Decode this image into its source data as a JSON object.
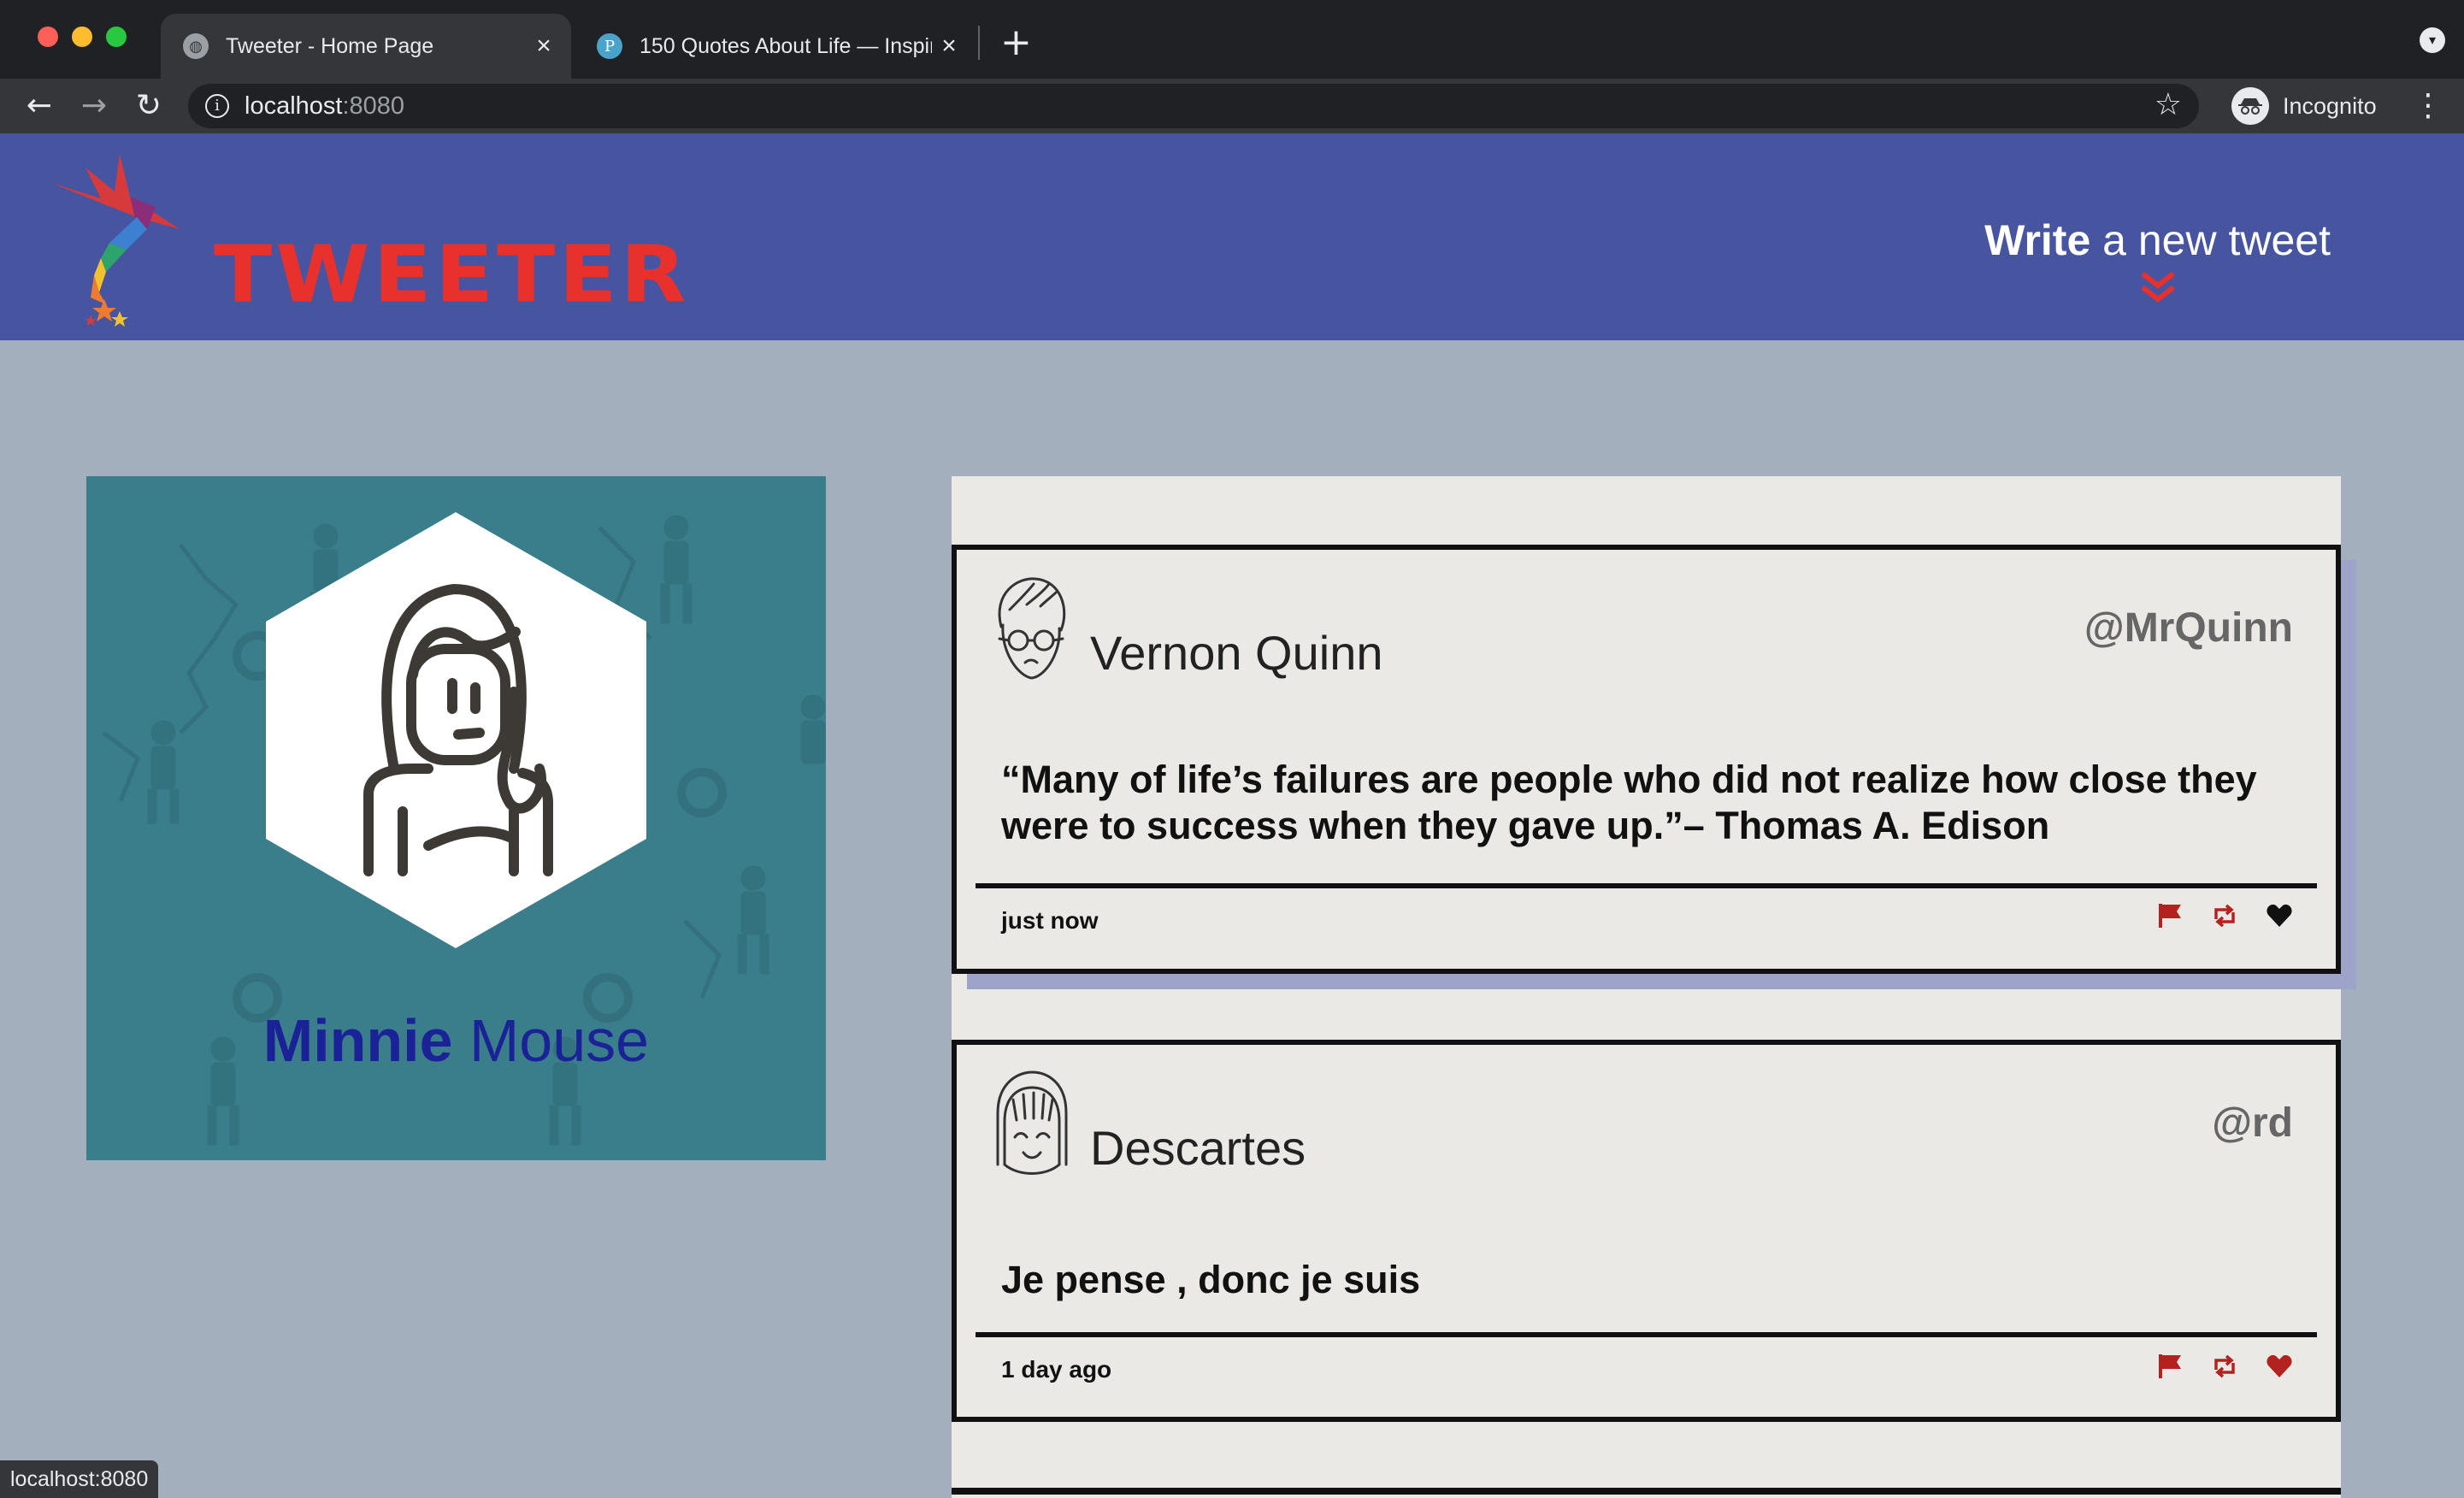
{
  "browser": {
    "tabs": [
      {
        "title": "Tweeter - Home Page",
        "favicon": "globe-icon",
        "active": true
      },
      {
        "title": "150 Quotes About Life — Inspir",
        "favicon": "P",
        "active": false
      }
    ],
    "address": {
      "host": "localhost",
      "port": ":8080"
    },
    "profile_label": "Incognito",
    "status_url": "localhost:8080"
  },
  "header": {
    "brand": "TWEETER",
    "compose_bold": "Write",
    "compose_rest": " a new tweet",
    "colors": {
      "nav": "#4755a1",
      "accent": "#e8302d"
    }
  },
  "profile": {
    "first_name": "Minnie",
    "last_name": "Mouse",
    "colors": {
      "card": "#3a7d8b",
      "name": "#1b2196"
    }
  },
  "tweets": [
    {
      "author": "Vernon Quinn",
      "handle": "@MrQuinn",
      "text": "“Many of life’s failures are people who did not realize how close they were to success when they gave up.”– Thomas A. Edison",
      "time": "just now",
      "actions": [
        "flag-icon",
        "retweet-icon",
        "heart-icon"
      ],
      "liked": false
    },
    {
      "author": "Descartes",
      "handle": "@rd",
      "text": "Je pense , donc je suis",
      "time": "1 day ago",
      "actions": [
        "flag-icon",
        "retweet-icon",
        "heart-icon"
      ],
      "liked": true
    }
  ]
}
